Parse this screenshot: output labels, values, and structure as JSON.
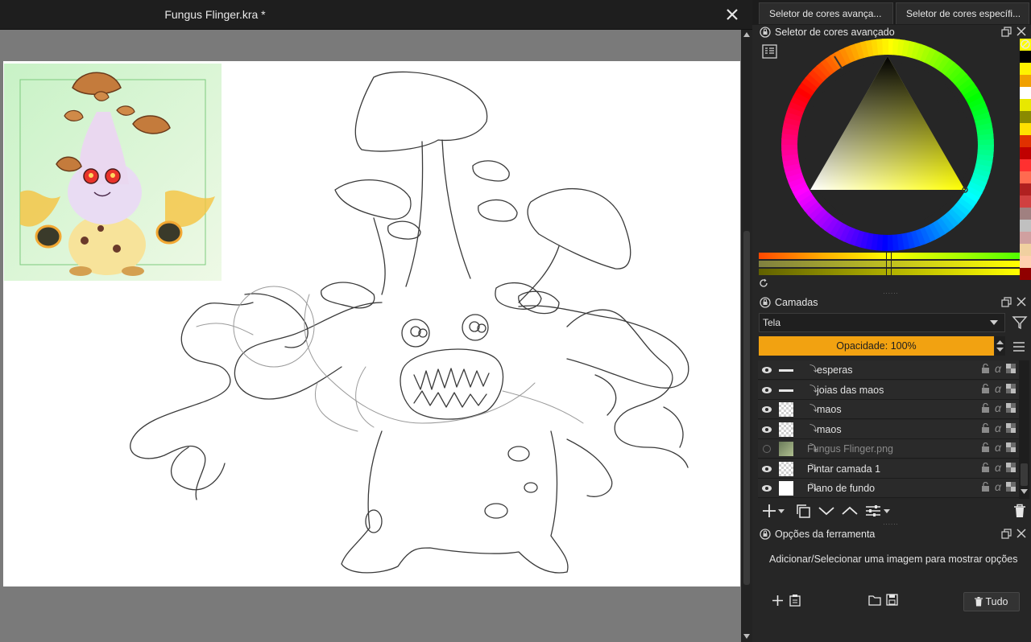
{
  "document": {
    "title": "Fungus Flinger.kra *"
  },
  "dock_tabs": [
    {
      "label": "Seletor de cores avança..."
    },
    {
      "label": "Seletor de cores específi..."
    }
  ],
  "color_selector": {
    "title": "Seletor de cores avançado",
    "hue_color": "#ffff00"
  },
  "palette": [
    "#ffff00",
    "#000000",
    "#fff200",
    "#f0a000",
    "#ffffff",
    "#e8e800",
    "#8a8a00",
    "#ffe000",
    "#e03000",
    "#c00000",
    "#ff3030",
    "#ff6a50",
    "#b02020",
    "#d04040",
    "#a08080",
    "#c0c0c0",
    "#d0a0a0",
    "#f0d0a0",
    "#ffd0b0",
    "#900000"
  ],
  "layers": {
    "title": "Camadas",
    "blend_mode": "Tela",
    "opacity_label": "Opacidade:  100%",
    "items": [
      {
        "name": "esperas",
        "visible": true,
        "thumb": "stroke"
      },
      {
        "name": "joias das maos",
        "visible": true,
        "thumb": "stroke"
      },
      {
        "name": "maos",
        "visible": true,
        "thumb": "checker"
      },
      {
        "name": "maos",
        "visible": true,
        "thumb": "checker"
      },
      {
        "name": "Fungus Flinger.png",
        "visible": false,
        "thumb": "image"
      },
      {
        "name": "Pintar camada 1",
        "visible": true,
        "thumb": "checker"
      },
      {
        "name": "Plano de fundo",
        "visible": true,
        "thumb": "white"
      }
    ]
  },
  "tool_options": {
    "title": "Opções da ferramenta",
    "message": "Adicionar/Selecionar uma imagem para mostrar opções",
    "all_button": "Tudo"
  }
}
